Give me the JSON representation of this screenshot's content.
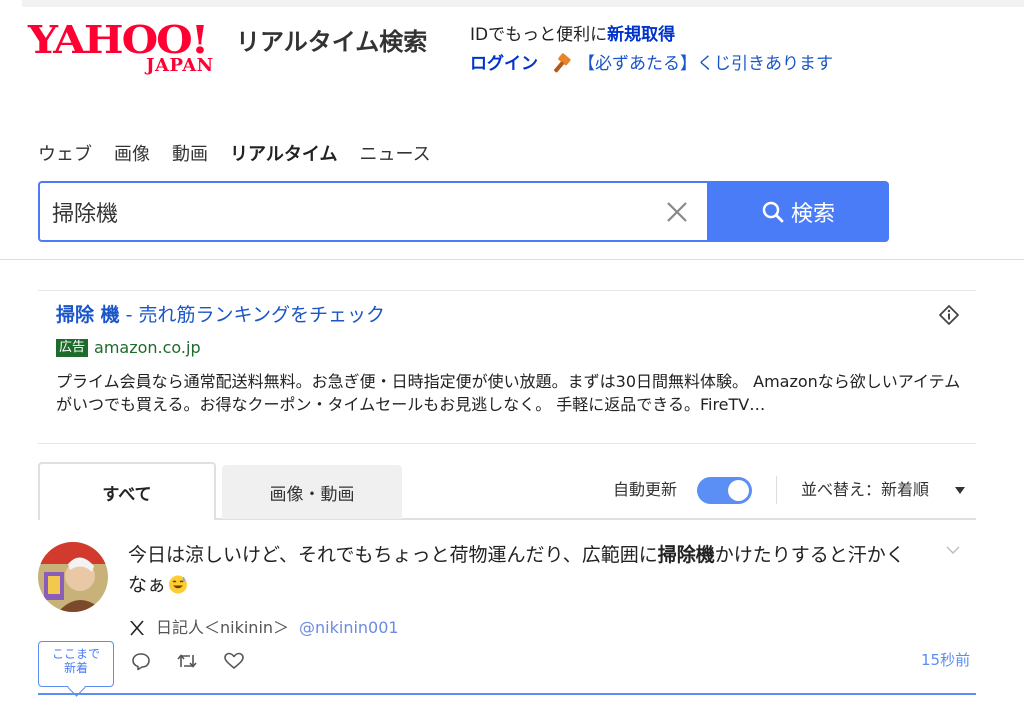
{
  "header": {
    "logo_text": "YAHOO!",
    "logo_sub": "JAPAN",
    "service_name": "リアルタイム検索",
    "id_prefix": "IDでもっと便利に",
    "register_link": "新規取得",
    "login_link": "ログイン",
    "lottery_text": "【必ずあたる】くじ引きあります"
  },
  "search_tabs": [
    {
      "label": "ウェブ"
    },
    {
      "label": "画像"
    },
    {
      "label": "動画"
    },
    {
      "label": "リアルタイム",
      "active": true
    },
    {
      "label": "ニュース"
    }
  ],
  "search": {
    "query": "掃除機",
    "button_label": "検索"
  },
  "ad": {
    "title_keyword": "掃除 機",
    "title_rest": " - 売れ筋ランキングをチェック",
    "badge": "広告",
    "domain": "amazon.co.jp",
    "description": "プライム会員なら通常配送料無料。お急ぎ便・日時指定便が使い放題。まずは30日間無料体験。 Amazonなら欲しいアイテムがいつでも買える。お得なクーポン・タイムセールもお見逃しなく。 手軽に返品できる。FireTV…"
  },
  "result_tabs": {
    "all": "すべて",
    "media": "画像・動画",
    "auto_update_label": "自動更新",
    "auto_update_on": true,
    "sort_label": "並べ替え：新着順"
  },
  "tweet": {
    "text_before": "今日は涼しいけど、それでもちょっと荷物運んだり、広範囲に",
    "text_keyword": "掃除機",
    "text_after": "かけたりすると汗かくなぁ",
    "emoji": "smiling-face-with-sweat-icon",
    "author_name": "日記人＜nikinin＞",
    "author_handle": "@nikinin001",
    "timestamp": "15秒前",
    "new_marker_line1": "ここまで",
    "new_marker_line2": "新着"
  },
  "colors": {
    "brand_red": "#ff0033",
    "link_blue": "#0033cc",
    "accent_blue": "#4a7cf7",
    "ad_green": "#1e6b2b"
  }
}
